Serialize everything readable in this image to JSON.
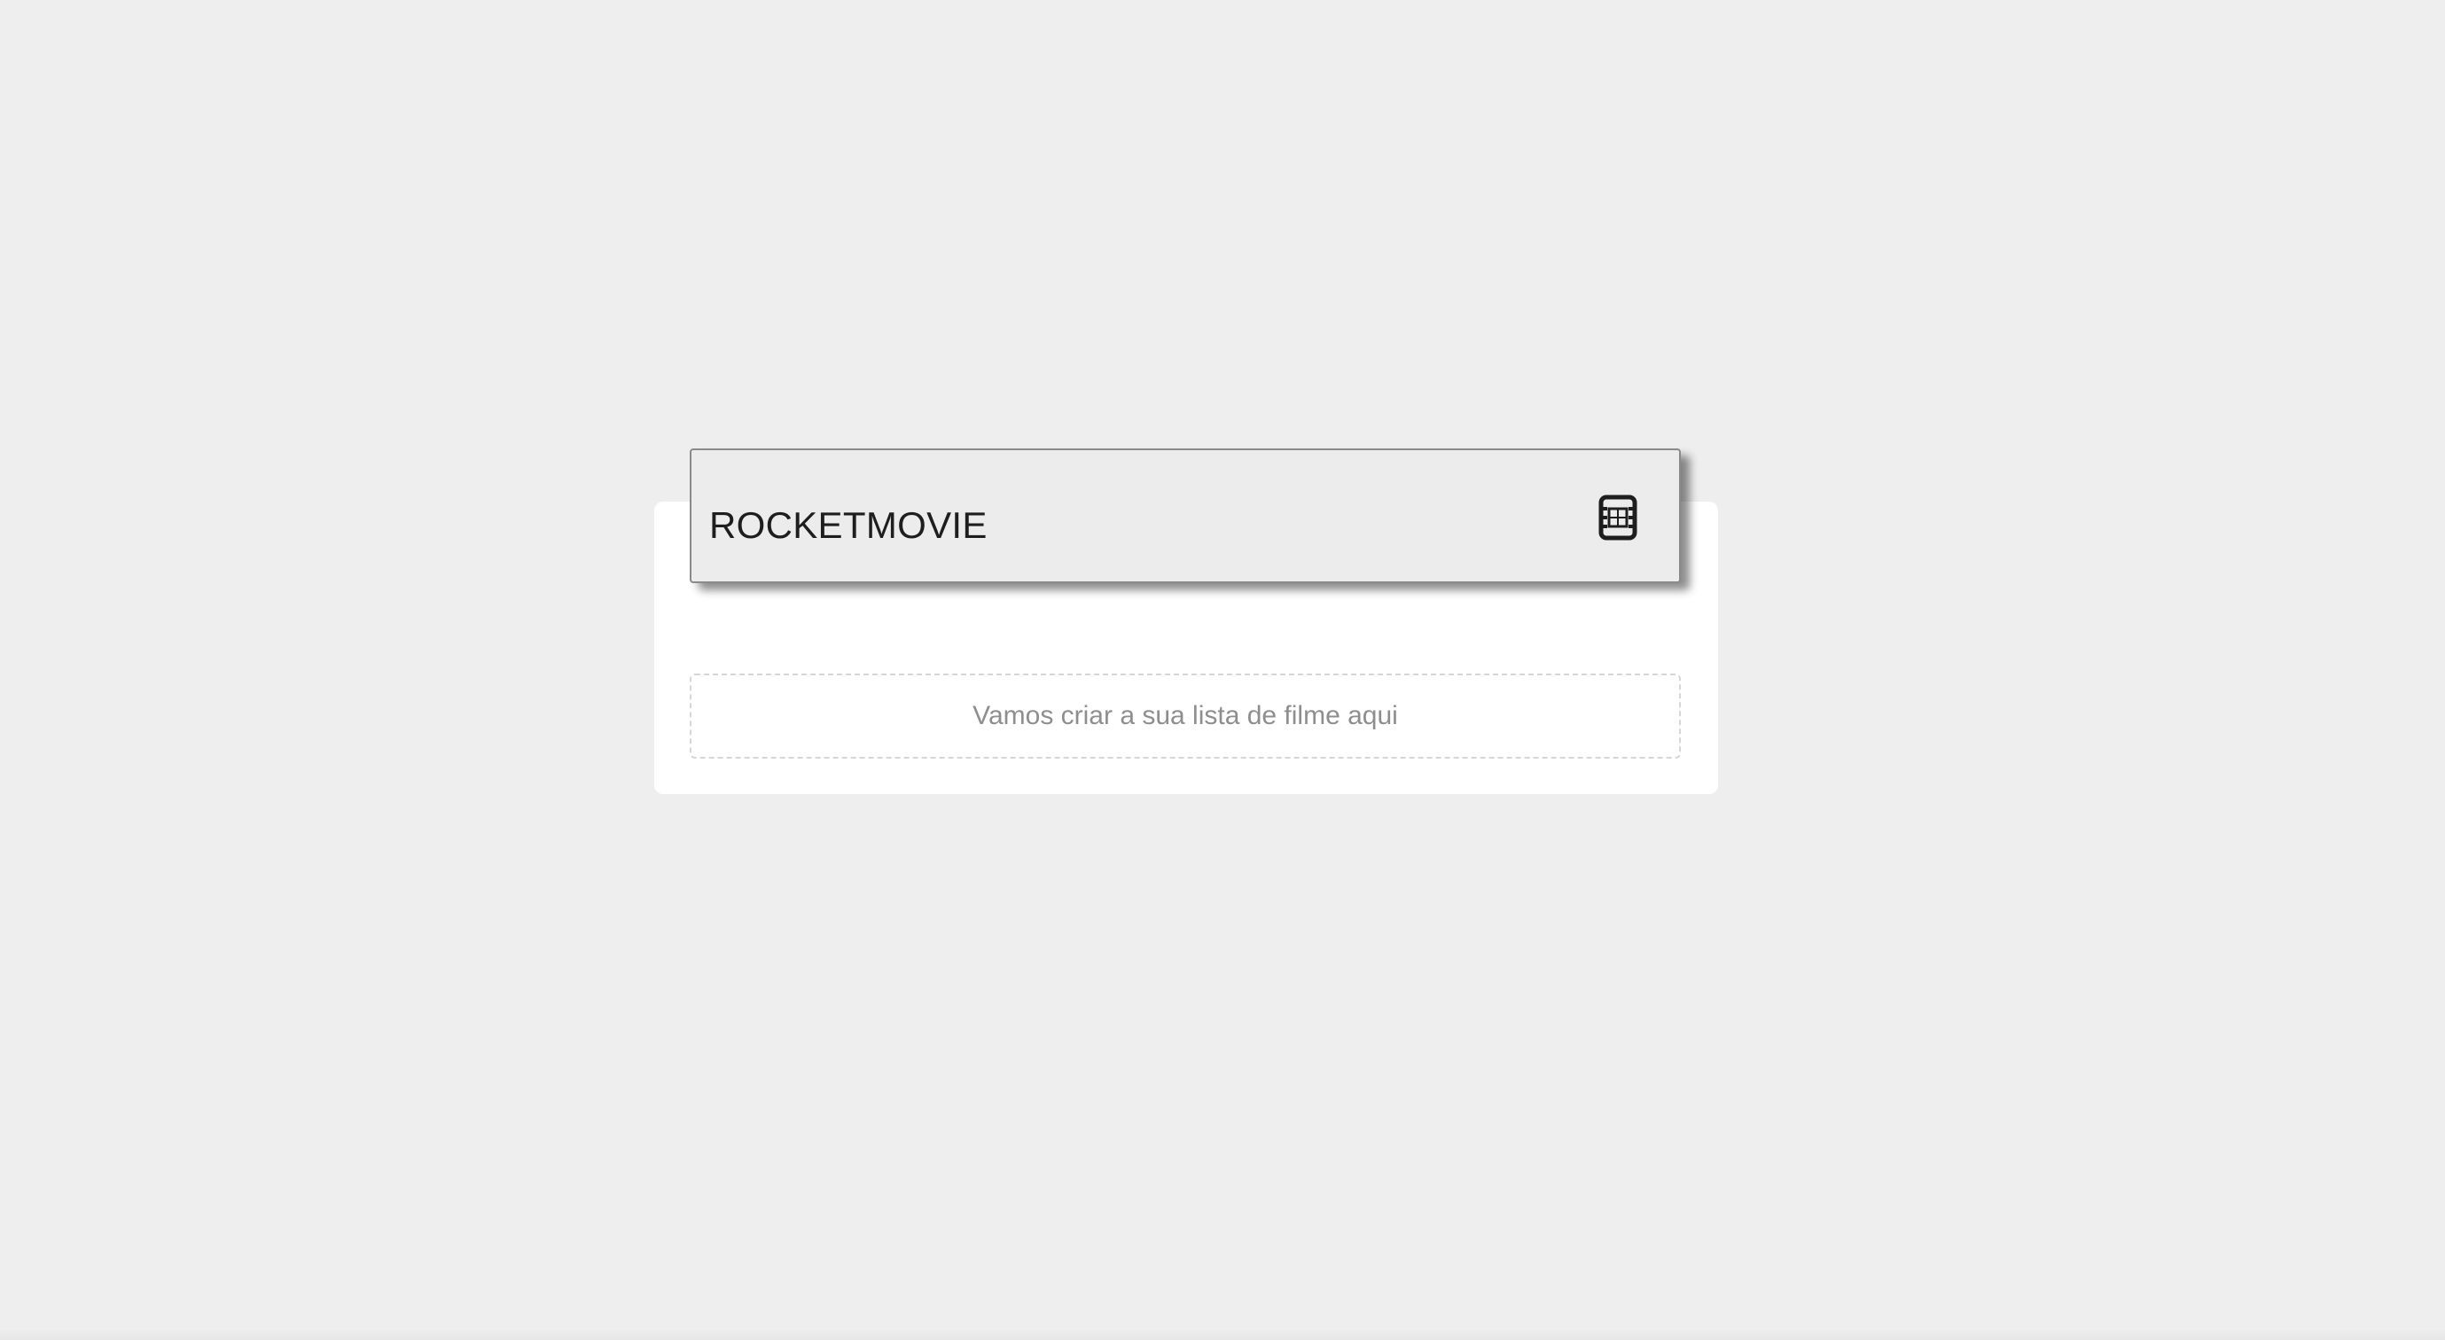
{
  "app": {
    "title": "ROCKETMOVIE",
    "icon": "film-icon"
  },
  "movie_list": {
    "empty_message": "Vamos criar a sua lista de filme aqui"
  },
  "colors": {
    "page_background": "#eeeeee",
    "card_background": "#ffffff",
    "header_background": "#ececec",
    "title_text": "#1e1e1e",
    "empty_text": "#8e8e8e",
    "dashed_border": "#d6d6d6"
  }
}
